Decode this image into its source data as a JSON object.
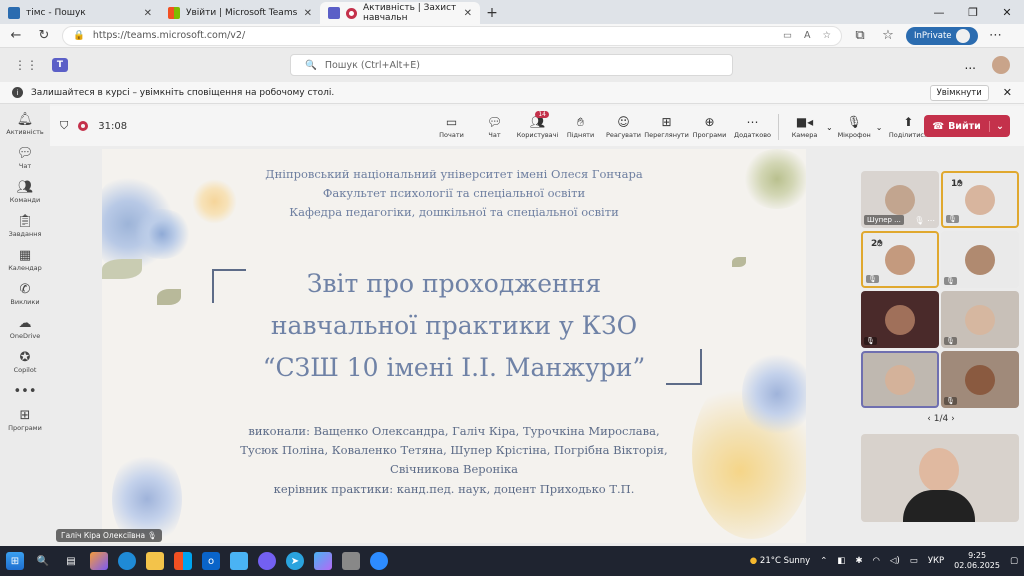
{
  "tabs": [
    {
      "title": "тімс - Пошук",
      "favicon_color": "#2b6cb0"
    },
    {
      "title": "Увійти | Microsoft Teams",
      "favicon_color": "#f25022"
    },
    {
      "title": "Активність | Захист навчальн",
      "favicon_color": "#5b5fc7"
    }
  ],
  "address": {
    "url": "https://teams.microsoft.com/v2/",
    "inprivate_label": "InPrivate"
  },
  "teams": {
    "search_placeholder": "Пошук (Ctrl+Alt+E)",
    "more": "..."
  },
  "notice": {
    "text": "Залишайтеся в курсі – увімкніть сповіщення на робочому столі.",
    "button": "Увімкнути"
  },
  "rail": [
    {
      "label": "Активність",
      "icon": "bell-icon"
    },
    {
      "label": "Чат",
      "icon": "chat-icon"
    },
    {
      "label": "Команди",
      "icon": "teams-icon"
    },
    {
      "label": "Завдання",
      "icon": "assignments-icon"
    },
    {
      "label": "Календар",
      "icon": "calendar-icon"
    },
    {
      "label": "Виклики",
      "icon": "phone-icon"
    },
    {
      "label": "OneDrive",
      "icon": "cloud-icon"
    },
    {
      "label": "Copilot",
      "icon": "copilot-icon"
    },
    {
      "label": "",
      "icon": "more-icon"
    },
    {
      "label": "Програми",
      "icon": "apps-icon"
    }
  ],
  "meeting": {
    "timer": "31:08",
    "controls": [
      {
        "label": "Почати",
        "icon": "share-icon"
      },
      {
        "label": "Чат",
        "icon": "chat-icon"
      },
      {
        "label": "Користувачі",
        "icon": "people-icon",
        "badge": "14"
      },
      {
        "label": "Підняти",
        "icon": "hand-icon"
      },
      {
        "label": "Реагувати",
        "icon": "smile-icon"
      },
      {
        "label": "Переглянути",
        "icon": "view-icon"
      },
      {
        "label": "Програми",
        "icon": "plus-icon"
      },
      {
        "label": "Додатково",
        "icon": "more-icon"
      }
    ],
    "media": [
      {
        "label": "Камера",
        "icon": "camera-icon"
      },
      {
        "label": "Мікрофон",
        "icon": "mic-icon"
      },
      {
        "label": "Поділитися",
        "icon": "share-up-icon"
      }
    ],
    "leave_label": "Вийти",
    "presenter": "Галіч Кіра Олексіївна"
  },
  "slide": {
    "header": [
      "Дніпровський національний університет імені Олеся Гончара",
      "Факультет психології та спеціальної освіти",
      "Кафедра педагогіки, дошкільної та спеціальної освіти"
    ],
    "title": [
      "Звіт про проходження",
      "навчальної практики у КЗО",
      "“СЗШ 10 імені І.І. Манжури”"
    ],
    "authors": [
      "виконали: Ващенко Олександра, Галіч Кіра, Турочкіна Мирослава,",
      "Тусюк Поліна, Коваленко Тетяна, Шупер Крістіна, Погрібна Вікторія,",
      "Свічникова Вероніка",
      "керівник практики: канд.пед. наук, доцент Приходько Т.П."
    ]
  },
  "gallery": {
    "tile_name": "Шупер ...",
    "hand_1": "1",
    "hand_2": "2",
    "pager": "1/4"
  },
  "taskbar": {
    "weather_temp": "21°C",
    "weather_text": "Sunny",
    "lang": "УКР",
    "time": "9:25",
    "date": "02.06.2025"
  }
}
